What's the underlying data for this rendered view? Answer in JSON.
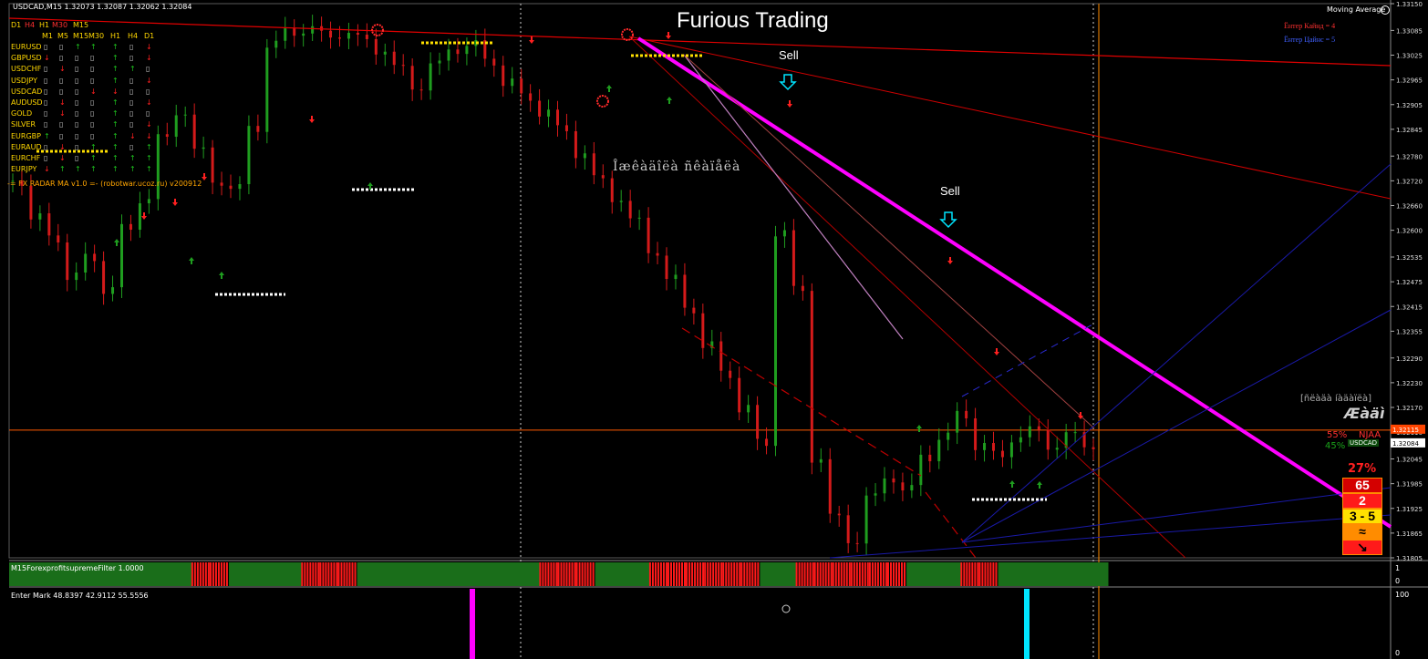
{
  "header": {
    "symbol_line": "USDCAD,M15  1.32073 1.32087 1.32062 1.32084",
    "title": "Furious Trading",
    "ma_label": "Moving Average"
  },
  "entries": {
    "line1": "Ёнтер Кайнд = 4",
    "line2": "Ёнтер Цайнс = 5"
  },
  "radar": {
    "tf_top": [
      "D1",
      "H4",
      "H1",
      "M30",
      "M15"
    ],
    "tf_top_colors": [
      "#ffd700",
      "#ff3030",
      "#ffd700",
      "#ff3030",
      "#ffd700"
    ],
    "cols": [
      "M1",
      "M5",
      "M15",
      "M30",
      "H1",
      "H4",
      "D1"
    ],
    "rows": [
      {
        "sym": "EURUSD",
        "cells": [
          "n",
          "n",
          "u",
          "u",
          "u",
          "n",
          "d"
        ]
      },
      {
        "sym": "GBPUSD",
        "cells": [
          "d",
          "n",
          "n",
          "n",
          "u",
          "n",
          "d"
        ]
      },
      {
        "sym": "USDCHF",
        "cells": [
          "n",
          "d",
          "n",
          "n",
          "u",
          "u",
          "n"
        ]
      },
      {
        "sym": "USDJPY",
        "cells": [
          "n",
          "n",
          "n",
          "n",
          "u",
          "n",
          "d"
        ]
      },
      {
        "sym": "USDCAD",
        "cells": [
          "n",
          "n",
          "n",
          "d",
          "d",
          "n",
          "n"
        ]
      },
      {
        "sym": "AUDUSD",
        "cells": [
          "n",
          "d",
          "n",
          "n",
          "u",
          "n",
          "d"
        ]
      },
      {
        "sym": "GOLD",
        "cells": [
          "n",
          "d",
          "n",
          "n",
          "u",
          "n",
          "n"
        ]
      },
      {
        "sym": "SILVER",
        "cells": [
          "n",
          "n",
          "n",
          "n",
          "u",
          "n",
          "d"
        ]
      },
      {
        "sym": "EURGBP",
        "cells": [
          "u",
          "n",
          "n",
          "n",
          "u",
          "d",
          "d"
        ]
      },
      {
        "sym": "EURAUD",
        "cells": [
          "n",
          "d",
          "n",
          "u",
          "u",
          "n",
          "u"
        ]
      },
      {
        "sym": "EURCHF",
        "cells": [
          "n",
          "d",
          "n",
          "u",
          "u",
          "u",
          "u"
        ]
      },
      {
        "sym": "EURJPY",
        "cells": [
          "d",
          "u",
          "u",
          "u",
          "u",
          "u",
          "u"
        ]
      }
    ],
    "footer": "-= FX RADAR MA v1.0 =- (robotwar.ucoz.ru) v200912"
  },
  "annotations": {
    "sell1": "Sell",
    "sell2": "Sell",
    "garbled_text": "Îæêàäîëà ñêàïåëà",
    "right_garbled": "[ñëàäà íàäàïëà]",
    "right_big": "Æàäì"
  },
  "right_panel": {
    "pct_red": "55%",
    "pct_green": "45%",
    "mini_label": "USDCAD",
    "big_pct": "27%",
    "n1": "65",
    "n2": "2",
    "n3": "3 - 5",
    "ncad": "NJAA"
  },
  "price_axis": {
    "ticks": [
      "1.33150",
      "1.33085",
      "1.33025",
      "1.32965",
      "1.32905",
      "1.32845",
      "1.32780",
      "1.32720",
      "1.32660",
      "1.32600",
      "1.32535",
      "1.32475",
      "1.32415",
      "1.32355",
      "1.32290",
      "1.32230",
      "1.32170",
      "1.32110",
      "1.32045",
      "1.31985",
      "1.31925",
      "1.31865",
      "1.31805"
    ],
    "current_price": "1.32084",
    "hline_price": "1.32115"
  },
  "subwindows": {
    "filter_label": "M15ForexprofitsupremeFilter 1.0000",
    "filter_scale": [
      "1",
      "0"
    ],
    "mark_label": "Enter Mark 48.8397 42.9112 55.5556",
    "mark_scale": [
      "100",
      "0"
    ]
  },
  "chart_data": {
    "type": "candlestick",
    "symbol": "USDCAD",
    "timeframe": "M15",
    "ylim": [
      1.31805,
      1.3315
    ],
    "open": 1.32073,
    "high": 1.32087,
    "low": 1.32062,
    "close": 1.32084,
    "x": [
      0,
      1,
      2,
      3,
      4,
      5,
      6,
      7,
      8,
      9,
      10,
      11,
      12,
      13,
      14,
      15,
      16,
      17,
      18,
      19,
      20,
      21,
      22,
      23,
      24,
      25,
      26,
      27,
      28,
      29,
      30,
      31,
      32,
      33,
      34,
      35,
      36,
      37,
      38,
      39,
      40,
      41,
      42,
      43,
      44,
      45,
      46,
      47,
      48,
      49,
      50,
      51,
      52,
      53,
      54,
      55,
      56,
      57,
      58,
      59
    ],
    "close_series": [
      1.3272,
      1.3263,
      1.3258,
      1.3249,
      1.3253,
      1.3246,
      1.326,
      1.3268,
      1.3282,
      1.3289,
      1.3279,
      1.3272,
      1.327,
      1.3285,
      1.3305,
      1.3308,
      1.3309,
      1.3307,
      1.3308,
      1.3306,
      1.3304,
      1.3299,
      1.3295,
      1.33,
      1.3304,
      1.3305,
      1.3301,
      1.3296,
      1.3292,
      1.3289,
      1.3284,
      1.3279,
      1.3272,
      1.3268,
      1.3262,
      1.3255,
      1.3248,
      1.3241,
      1.3232,
      1.3225,
      1.3217,
      1.3208,
      1.326,
      1.3245,
      1.3205,
      1.319,
      1.3185,
      1.3195,
      1.32,
      1.3197,
      1.3205,
      1.321,
      1.3215,
      1.3208,
      1.3205,
      1.321,
      1.3211,
      1.3208,
      1.321,
      1.3208
    ],
    "filter_states": [
      "g",
      "g",
      "g",
      "g",
      "g",
      "g",
      "g",
      "g",
      "g",
      "g",
      "r",
      "r",
      "g",
      "g",
      "g",
      "g",
      "r",
      "r",
      "r",
      "g",
      "g",
      "g",
      "g",
      "g",
      "g",
      "g",
      "g",
      "g",
      "g",
      "r",
      "r",
      "r",
      "g",
      "g",
      "g",
      "r",
      "r",
      "r",
      "r",
      "r",
      "r",
      "g",
      "g",
      "r",
      "r",
      "r",
      "r",
      "r",
      "r",
      "g",
      "g",
      "g",
      "r",
      "r",
      "g",
      "g",
      "g",
      "g",
      "g",
      "g"
    ],
    "sell_signals": [
      {
        "label": "Sell"
      },
      {
        "label": "Sell"
      }
    ]
  }
}
